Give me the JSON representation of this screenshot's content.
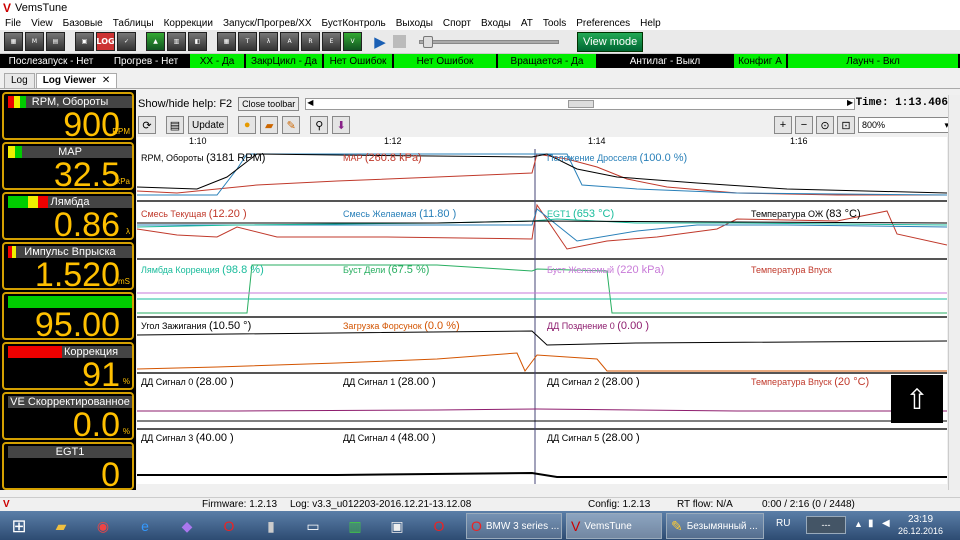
{
  "window": {
    "title": "VemsTune"
  },
  "menu": [
    "File",
    "View",
    "Базовые",
    "Таблицы",
    "Коррекции",
    "Запуск/Прогрев/ХХ",
    "БустКонтроль",
    "Выходы",
    "Спорт",
    "Входы",
    "AT",
    "Tools",
    "Preferences",
    "Help"
  ],
  "toolbar": {
    "view_mode": "View mode",
    "log_label": "LOG",
    "progress": 0.02
  },
  "status_flags": [
    {
      "label": "Послезапуск - Нет",
      "color": "black"
    },
    {
      "label": "Прогрев - Нет",
      "color": "black"
    },
    {
      "label": "ХХ - Да",
      "color": "green"
    },
    {
      "label": "ЗакрЦикл - Да",
      "color": "green"
    },
    {
      "label": "Нет Ошибок",
      "color": "green"
    },
    {
      "label": "Нет Ошибок",
      "color": "green"
    },
    {
      "label": "Вращается - Да",
      "color": "green"
    },
    {
      "label": "Антилаг - Выкл",
      "color": "black"
    },
    {
      "label": "Конфиг А",
      "color": "green"
    },
    {
      "label": "Лаунч - Вкл",
      "color": "green"
    }
  ],
  "tabs": [
    {
      "label": "Log"
    },
    {
      "label": "Log Viewer",
      "close": "✕"
    }
  ],
  "gauges": [
    {
      "label": "RPM, Обороты",
      "value": "900",
      "unit": "RPM"
    },
    {
      "label": "MAP",
      "value": "32.5",
      "unit": "kPa"
    },
    {
      "label": "Лямбда",
      "value": "0.86",
      "unit": "λ"
    },
    {
      "label": "Импульс Впрыска",
      "value": "1.520",
      "unit": "mS"
    },
    {
      "label": "",
      "value": "95.00",
      "unit": ""
    },
    {
      "label": "Лямбда Коррекция",
      "value": "91",
      "unit": "%"
    },
    {
      "label": "VE Скорректированное",
      "value": "0.0",
      "unit": "%"
    },
    {
      "label": "EGT1",
      "value": "0",
      "unit": ""
    }
  ],
  "logviewer": {
    "help_label": "Show/hide help: F2",
    "toolbar_button": "Close toolbar",
    "time_label": "Time: 1:13.406",
    "update_button": "Update",
    "zoom": "800%",
    "time_ticks": [
      "1:10",
      "1:12",
      "1:14",
      "1:16"
    ]
  },
  "channels": [
    [
      {
        "name": "RPM, Обороты",
        "value": "(3181 RPM)",
        "color": "#000000"
      },
      {
        "name": "MAP",
        "value": "(260.8 kPa)",
        "color": "#c0392b"
      },
      {
        "name": "Положение Дросселя",
        "value": "(100.0 %)",
        "color": "#2980b9"
      }
    ],
    [
      {
        "name": "Смесь Текущая",
        "value": "(12.20 )",
        "color": "#c0392b"
      },
      {
        "name": "Смесь Желаемая",
        "value": "(11.80 )",
        "color": "#2980b9"
      },
      {
        "name": "EGT1",
        "value": "(653 °C)",
        "color": "#1abc9c"
      },
      {
        "name": "Температура ОЖ",
        "value": "(83 °C)",
        "color": "#000000"
      }
    ],
    [
      {
        "name": "Лямбда Коррекция",
        "value": "(98.8 %)",
        "color": "#1abc9c"
      },
      {
        "name": "Буст Дели",
        "value": "(67.5 %)",
        "color": "#27ae60"
      },
      {
        "name": "Буст Желаемый",
        "value": "(220 kPa)",
        "color": "#c87ad8"
      },
      {
        "name": "Температура Впуск",
        "value": "",
        "color": "#c0392b"
      }
    ],
    [
      {
        "name": "Угол Зажигания",
        "value": "(10.50 °)",
        "color": "#000000"
      },
      {
        "name": "Загрузка Форсунок",
        "value": "(0.0 %)",
        "color": "#d35400"
      },
      {
        "name": "ДД Позднение 0",
        "value": "(0.00 )",
        "color": "#8e1d6e"
      }
    ],
    [
      {
        "name": "ДД Сигнал 0",
        "value": "(28.00 )",
        "color": "#000000"
      },
      {
        "name": "ДД Сигнал 1",
        "value": "(28.00 )",
        "color": "#000000"
      },
      {
        "name": "ДД Сигнал 2",
        "value": "(28.00 )",
        "color": "#000000"
      },
      {
        "name": "Температура Впуск",
        "value": "(20 °C)",
        "color": "#c0392b"
      }
    ],
    [
      {
        "name": "ДД Сигнал 3",
        "value": "(40.00 )",
        "color": "#000000"
      },
      {
        "name": "ДД Сигнал 4",
        "value": "(48.00 )",
        "color": "#000000"
      },
      {
        "name": "ДД Сигнал 5",
        "value": "(28.00 )",
        "color": "#000000"
      }
    ]
  ],
  "bottom_status": {
    "firmware": "Firmware: 1.2.13",
    "log": "Log: v3.3_u012203-2016.12.21-13.12.08",
    "config": "Config: 1.2.13",
    "rtflow": "RT flow: N/A",
    "position": "0:00 / 2:16 (0 / 2448)"
  },
  "taskbar": {
    "apps": [
      {
        "label": "BMW 3 series ..."
      },
      {
        "label": "VemsTune"
      },
      {
        "label": "Безымянный ..."
      }
    ],
    "lang": "RU",
    "time": "23:19",
    "date": "26.12.2016"
  },
  "colors": {
    "gauge_border": "#d4a000",
    "gauge_value": "#ffc000",
    "status_green": "#00ee00"
  }
}
